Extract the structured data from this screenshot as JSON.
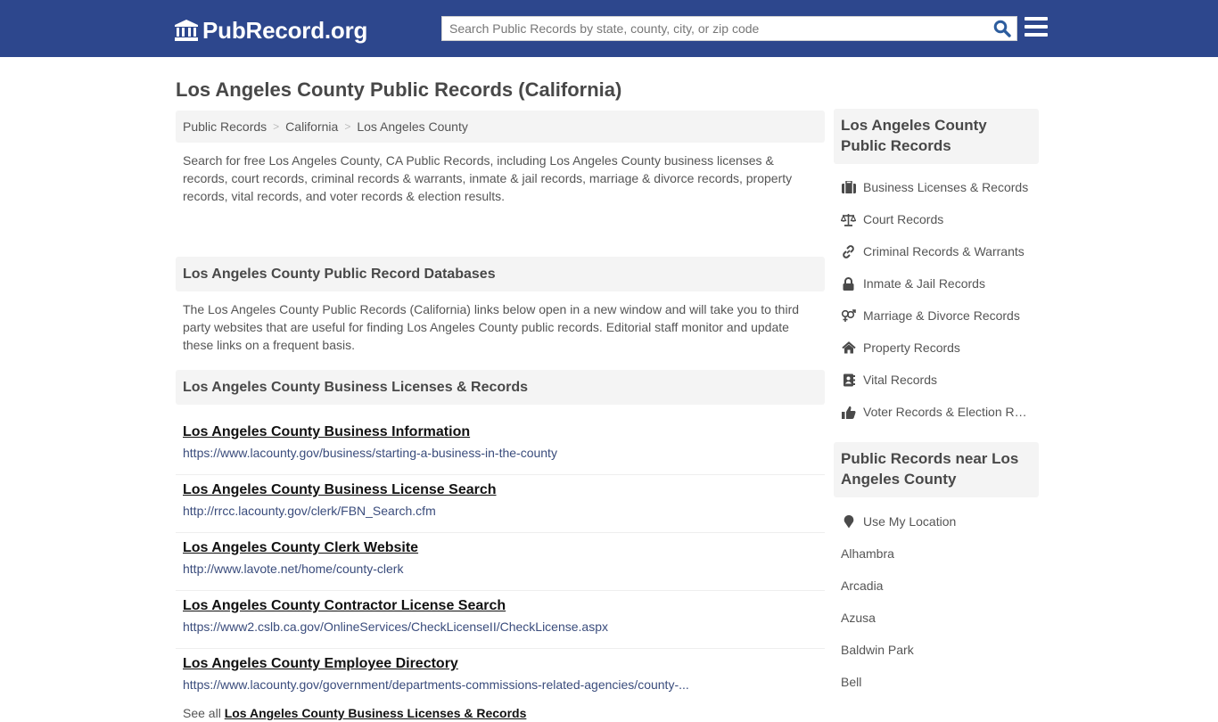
{
  "header": {
    "logo_text": "PubRecord.org",
    "search_placeholder": "Search Public Records by state, county, city, or zip code",
    "search_value": "",
    "brand_color": "#2d478d",
    "search_icon_color": "#2d5d9e"
  },
  "page": {
    "title": "Los Angeles County Public Records (California)"
  },
  "breadcrumb": {
    "items": [
      {
        "label": "Public Records"
      },
      {
        "label": "California"
      },
      {
        "label": "Los Angeles County"
      }
    ],
    "separator": ">"
  },
  "main": {
    "intro": "Search for free Los Angeles County, CA Public Records, including Los Angeles County business licenses & records, court records, criminal records & warrants, inmate & jail records, marriage & divorce records, property records, vital records, and voter records & election results.",
    "databases_heading": "Los Angeles County Public Record Databases",
    "databases_desc": "The Los Angeles County Public Records (California) links below open in a new window and will take you to third party websites that are useful for finding Los Angeles County public records. Editorial staff monitor and update these links on a frequent basis.",
    "business_heading": "Los Angeles County Business Licenses & Records",
    "records": [
      {
        "title": "Los Angeles County Business Information",
        "url": "https://www.lacounty.gov/business/starting-a-business-in-the-county"
      },
      {
        "title": "Los Angeles County Business License Search",
        "url": "http://rrcc.lacounty.gov/clerk/FBN_Search.cfm"
      },
      {
        "title": "Los Angeles County Clerk Website",
        "url": "http://www.lavote.net/home/county-clerk"
      },
      {
        "title": "Los Angeles County Contractor License Search",
        "url": "https://www2.cslb.ca.gov/OnlineServices/CheckLicenseII/CheckLicense.aspx"
      },
      {
        "title": "Los Angeles County Employee Directory",
        "url": "https://www.lacounty.gov/government/departments-commissions-related-agencies/county-..."
      }
    ],
    "see_all_prefix": "See all",
    "see_all_link": "Los Angeles County Business Licenses & Records"
  },
  "sidebar": {
    "records_heading": "Los Angeles County Public Records",
    "categories": [
      {
        "label": "Business Licenses & Records",
        "icon": "briefcase-icon"
      },
      {
        "label": "Court Records",
        "icon": "balance-scale-icon"
      },
      {
        "label": "Criminal Records & Warrants",
        "icon": "link-icon"
      },
      {
        "label": "Inmate & Jail Records",
        "icon": "lock-icon"
      },
      {
        "label": "Marriage & Divorce Records",
        "icon": "venus-mars-icon"
      },
      {
        "label": "Property Records",
        "icon": "home-icon"
      },
      {
        "label": "Vital Records",
        "icon": "address-book-icon"
      },
      {
        "label": "Voter Records & Election Results",
        "icon": "thumbs-up-icon"
      }
    ],
    "near_heading": "Public Records near Los Angeles County",
    "use_location": "Use My Location",
    "nearby": [
      "Alhambra",
      "Arcadia",
      "Azusa",
      "Baldwin Park",
      "Bell"
    ]
  }
}
